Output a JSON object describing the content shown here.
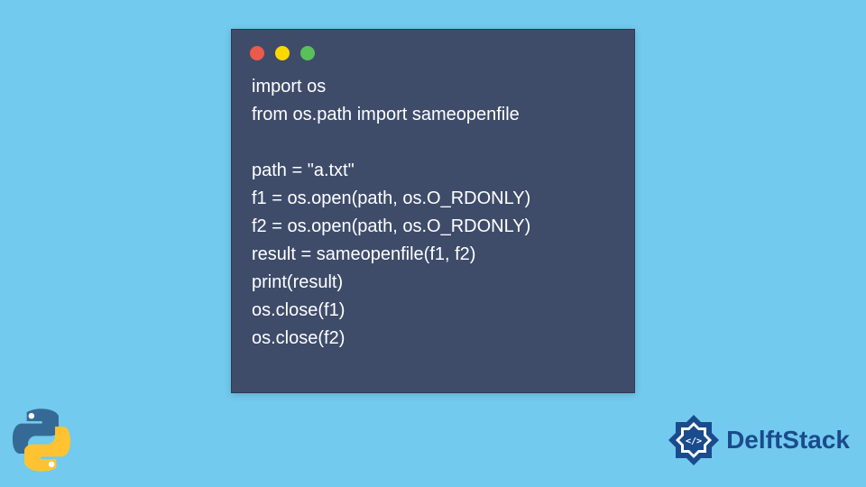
{
  "code": {
    "lines": [
      "import os",
      "from os.path import sameopenfile",
      "",
      "path = \"a.txt\"",
      "f1 = os.open(path, os.O_RDONLY)",
      "f2 = os.open(path, os.O_RDONLY)",
      "result = sameopenfile(f1, f2)",
      "print(result)",
      "os.close(f1)",
      "os.close(f2)"
    ]
  },
  "brand": {
    "name": "DelftStack"
  },
  "window": {
    "controls": [
      "red",
      "yellow",
      "green"
    ]
  }
}
